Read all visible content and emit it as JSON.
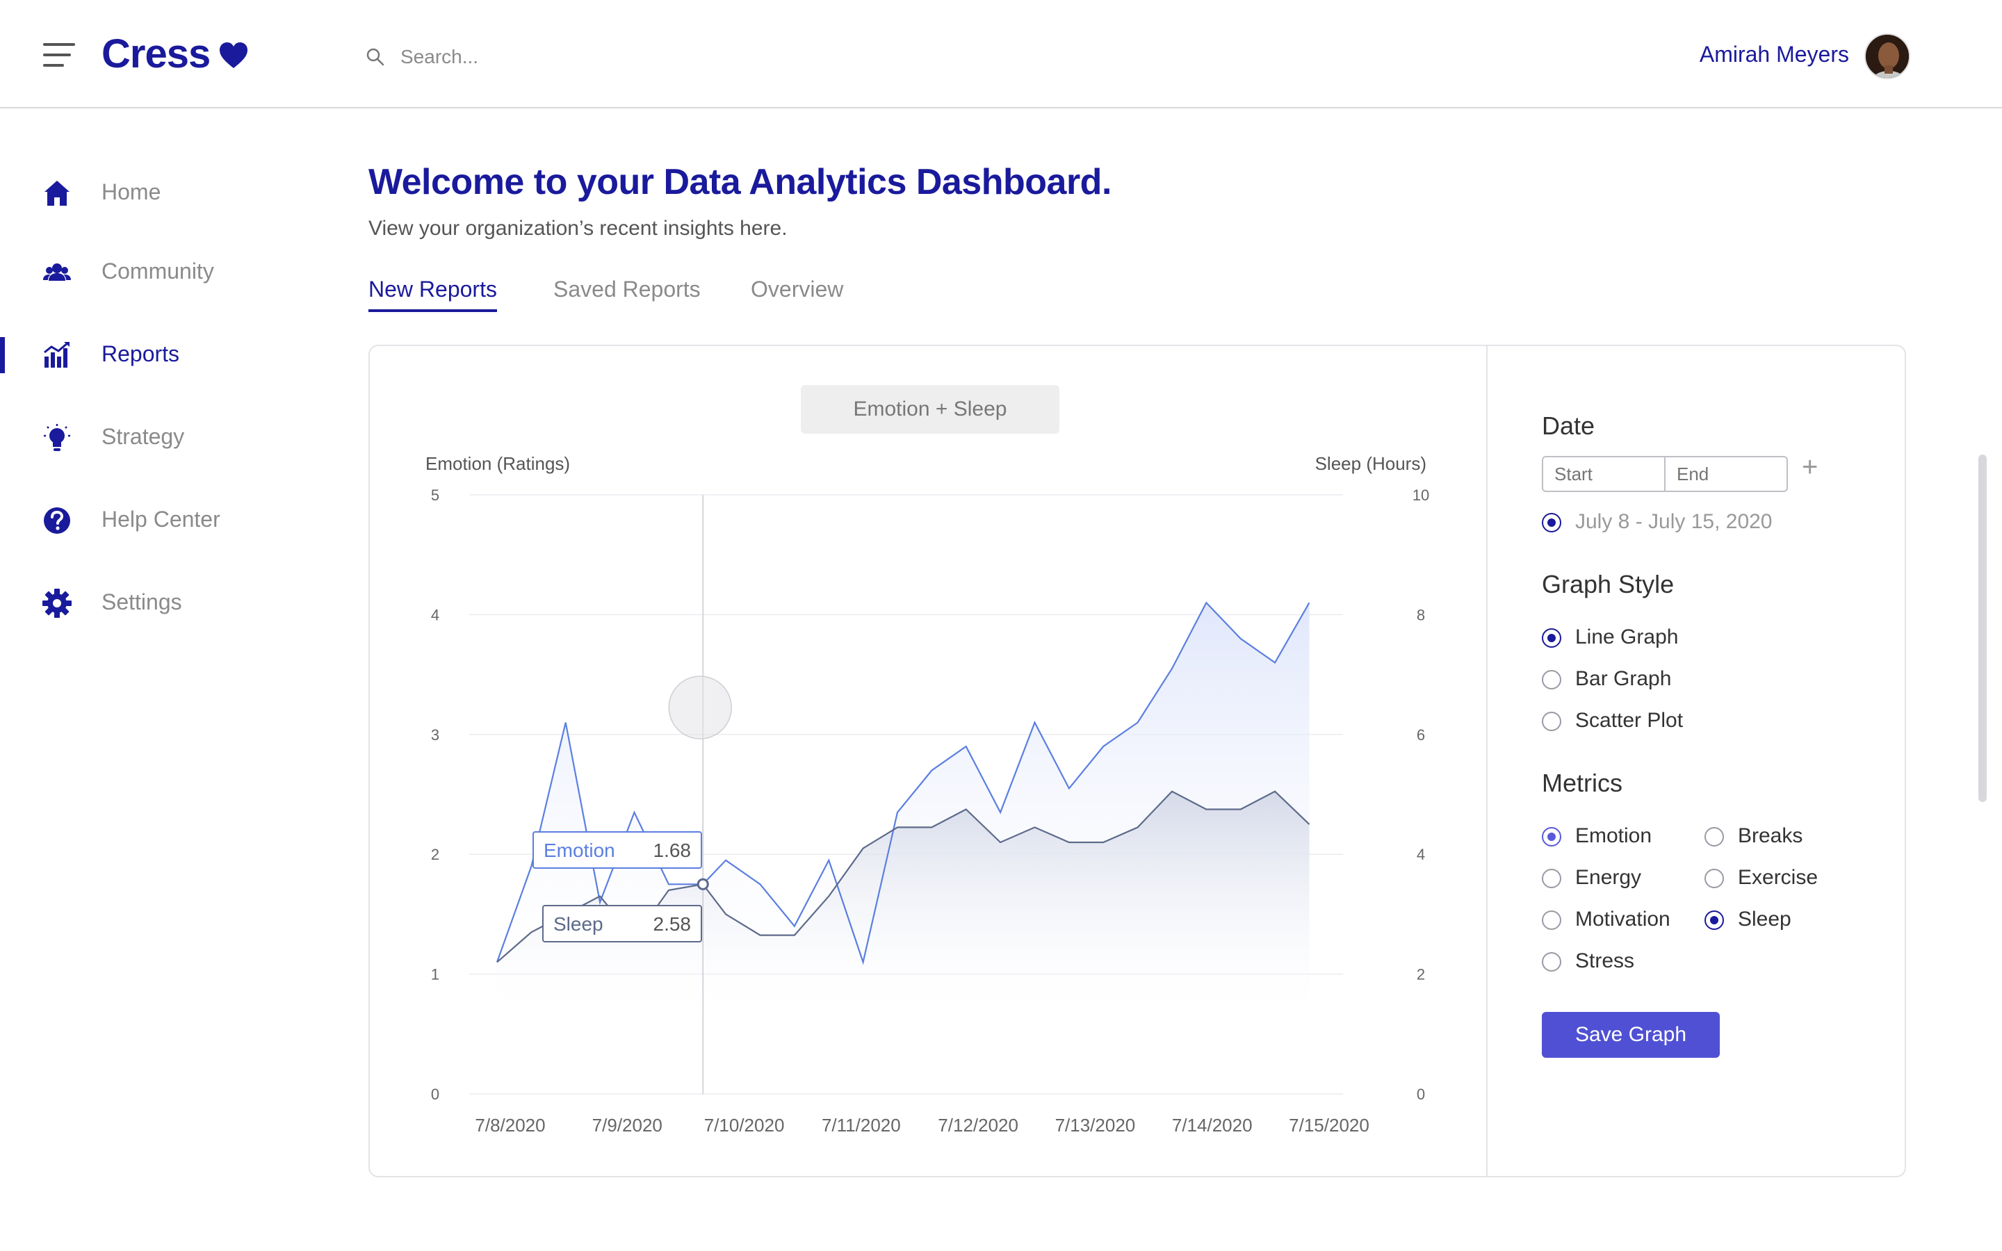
{
  "brand": {
    "name": "Cress",
    "color": "#1a1a9c"
  },
  "search": {
    "placeholder": "Search..."
  },
  "user": {
    "name": "Amirah Meyers"
  },
  "sidebar": {
    "items": [
      {
        "label": "Home",
        "icon": "home-icon"
      },
      {
        "label": "Community",
        "icon": "community-icon"
      },
      {
        "label": "Reports",
        "icon": "reports-icon",
        "active": true
      },
      {
        "label": "Strategy",
        "icon": "lightbulb-icon"
      },
      {
        "label": "Help Center",
        "icon": "help-icon"
      },
      {
        "label": "Settings",
        "icon": "gear-icon"
      }
    ]
  },
  "main": {
    "title": "Welcome to your Data Analytics Dashboard.",
    "subtitle": "View your organization’s recent insights here.",
    "tabs": [
      {
        "label": "New Reports",
        "active": true
      },
      {
        "label": "Saved Reports"
      },
      {
        "label": "Overview"
      }
    ]
  },
  "chart_data": {
    "type": "area",
    "title": "Emotion + Sleep",
    "left_axis": {
      "label": "Emotion (Ratings)",
      "ticks": [
        "0",
        "1",
        "2",
        "3",
        "4",
        "5"
      ],
      "range": [
        0,
        5
      ]
    },
    "right_axis": {
      "label": "Sleep (Hours)",
      "ticks": [
        "0",
        "2",
        "4",
        "6",
        "8",
        "10"
      ],
      "range": [
        0,
        10
      ]
    },
    "x_labels": [
      "7/8/2020",
      "7/9/2020",
      "7/10/2020",
      "7/11/2020",
      "7/12/2020",
      "7/13/2020",
      "7/14/2020",
      "7/15/2020"
    ],
    "x_range": [
      0,
      7
    ],
    "series": [
      {
        "name": "Emotion",
        "axis": "left",
        "color": "#5b7fe0",
        "x": [
          0,
          0.3,
          0.6,
          0.9,
          1.2,
          1.5,
          1.8,
          2.0,
          2.3,
          2.6,
          2.9,
          3.2,
          3.5,
          3.8,
          4.1,
          4.4,
          4.7,
          5.0,
          5.3,
          5.6,
          5.9,
          6.2,
          6.5,
          6.8,
          7.1
        ],
        "values": [
          1.1,
          1.9,
          3.1,
          1.6,
          2.35,
          1.75,
          1.75,
          1.95,
          1.75,
          1.4,
          1.95,
          1.1,
          2.35,
          2.7,
          2.9,
          2.35,
          3.1,
          2.55,
          2.9,
          3.1,
          3.55,
          4.1,
          3.8,
          3.6,
          4.1
        ]
      },
      {
        "name": "Sleep",
        "axis": "right",
        "color": "#5d6a8a",
        "x": [
          0,
          0.3,
          0.6,
          0.9,
          1.2,
          1.5,
          1.8,
          2.0,
          2.3,
          2.6,
          2.9,
          3.2,
          3.5,
          3.8,
          4.1,
          4.4,
          4.7,
          5.0,
          5.3,
          5.6,
          5.9,
          6.2,
          6.5,
          6.8,
          7.1
        ],
        "values": [
          2.2,
          2.7,
          3.0,
          3.3,
          2.6,
          3.4,
          3.5,
          3.0,
          2.65,
          2.65,
          3.3,
          4.1,
          4.45,
          4.45,
          4.75,
          4.2,
          4.45,
          4.2,
          4.2,
          4.45,
          5.05,
          4.75,
          4.75,
          5.05,
          4.5
        ]
      }
    ],
    "tooltip": {
      "x": 1.8,
      "items": [
        {
          "name": "Emotion",
          "value": "1.68"
        },
        {
          "name": "Sleep",
          "value": "2.58"
        }
      ]
    },
    "grid": true
  },
  "panel": {
    "date": {
      "heading": "Date",
      "start_placeholder": "Start",
      "end_placeholder": "End",
      "plus_label": "+",
      "range_option": "July 8 - July 15, 2020"
    },
    "graph_style": {
      "heading": "Graph Style",
      "options": [
        {
          "label": "Line Graph",
          "selected": true
        },
        {
          "label": "Bar Graph",
          "selected": false
        },
        {
          "label": "Scatter Plot",
          "selected": false
        }
      ]
    },
    "metrics": {
      "heading": "Metrics",
      "options": [
        {
          "label": "Emotion",
          "selected": true
        },
        {
          "label": "Energy",
          "selected": false
        },
        {
          "label": "Motivation",
          "selected": false
        },
        {
          "label": "Stress",
          "selected": false
        },
        {
          "label": "Breaks",
          "selected": false
        },
        {
          "label": "Exercise",
          "selected": false
        },
        {
          "label": "Sleep",
          "selected": true
        }
      ]
    },
    "save_label": "Save Graph"
  }
}
